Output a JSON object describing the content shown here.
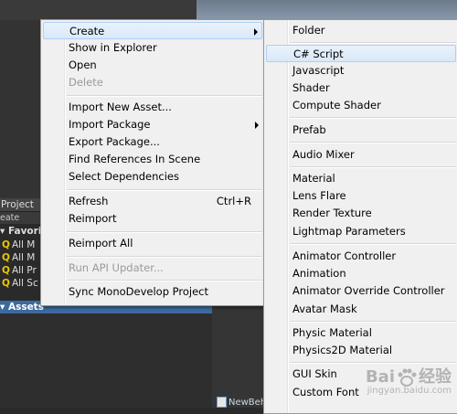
{
  "project_panel": {
    "tab_label": "Project",
    "create_label": "eate",
    "favorites_label": "Favori",
    "favorites_items": [
      "All M",
      "All M",
      "All Pr",
      "All Sc"
    ],
    "assets_label": "Assets",
    "file_label": "NewBeh"
  },
  "context_menu": {
    "items": [
      {
        "label": "Create"
      },
      {
        "label": "Show in Explorer"
      },
      {
        "label": "Open"
      },
      {
        "label": "Delete"
      },
      {
        "label": "Import New Asset..."
      },
      {
        "label": "Import Package"
      },
      {
        "label": "Export Package..."
      },
      {
        "label": "Find References In Scene"
      },
      {
        "label": "Select Dependencies"
      },
      {
        "label": "Refresh",
        "shortcut": "Ctrl+R"
      },
      {
        "label": "Reimport"
      },
      {
        "label": "Reimport All"
      },
      {
        "label": "Run API Updater..."
      },
      {
        "label": "Sync MonoDevelop Project"
      }
    ]
  },
  "create_submenu": {
    "items": [
      {
        "label": "Folder"
      },
      {
        "label": "C# Script"
      },
      {
        "label": "Javascript"
      },
      {
        "label": "Shader"
      },
      {
        "label": "Compute Shader"
      },
      {
        "label": "Prefab"
      },
      {
        "label": "Audio Mixer"
      },
      {
        "label": "Material"
      },
      {
        "label": "Lens Flare"
      },
      {
        "label": "Render Texture"
      },
      {
        "label": "Lightmap Parameters"
      },
      {
        "label": "Animator Controller"
      },
      {
        "label": "Animation"
      },
      {
        "label": "Animator Override Controller"
      },
      {
        "label": "Avatar Mask"
      },
      {
        "label": "Physic Material"
      },
      {
        "label": "Physics2D Material"
      },
      {
        "label": "GUI Skin"
      },
      {
        "label": "Custom Font"
      }
    ]
  },
  "watermark": {
    "text": "Bai",
    "suffix": "经验",
    "sub": "jingyan.baidu.com"
  }
}
